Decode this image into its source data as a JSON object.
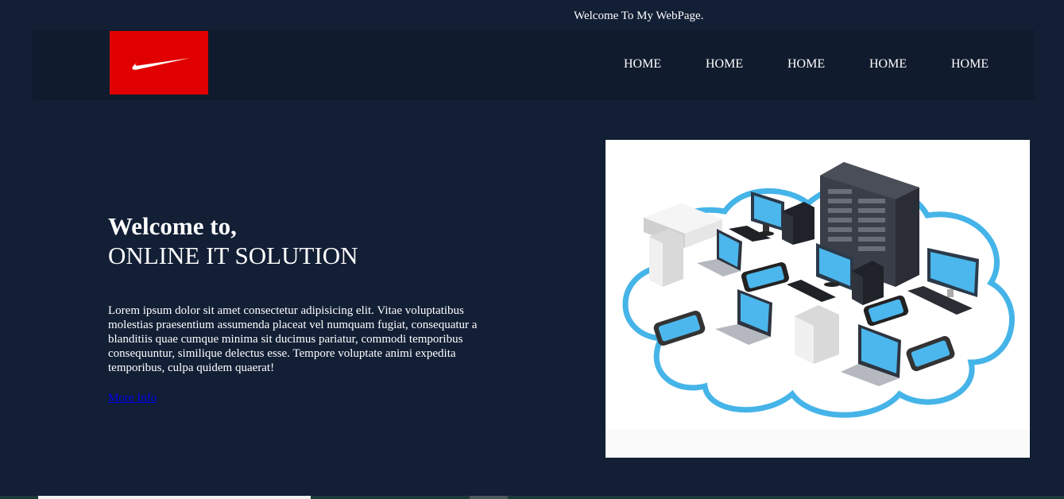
{
  "topbar": {
    "welcome_text": "Welcome To My WebPage."
  },
  "brand": {
    "logo_icon": "swoosh-logo",
    "logo_color": "#e00000"
  },
  "nav": {
    "items": [
      {
        "label": "HOME"
      },
      {
        "label": "HOME"
      },
      {
        "label": "HOME"
      },
      {
        "label": "HOME"
      },
      {
        "label": "HOME"
      }
    ]
  },
  "hero": {
    "title_line1": "Welcome to,",
    "title_line2": "ONLINE IT SOLUTION",
    "body": "Lorem ipsum dolor sit amet consectetur adipisicing elit. Vitae voluptatibus molestias praesentium assumenda placeat vel numquam fugiat, consequatur a blanditiis quae cumque minima sit ducimus pariatur, commodi temporibus consequuntur, similique delectus esse. Tempore voluptate animi expedita temporibus, culpa quidem quaerat!",
    "link_label": "More Info",
    "image_icon": "cloud-network-illustration"
  },
  "colors": {
    "page_background": "#121f35",
    "navbar_background": "#101b2d",
    "link": "#0000ee",
    "accent_blue": "#45b4e8"
  }
}
